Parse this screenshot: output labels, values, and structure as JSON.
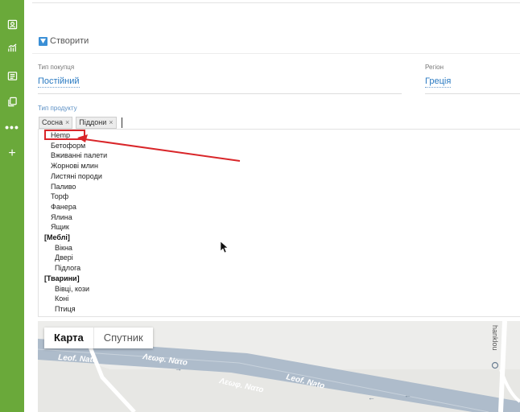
{
  "sidebar": {
    "icons": [
      "contacts-icon",
      "analytics-icon",
      "list-icon",
      "copy-icon",
      "more-icon",
      "add-icon"
    ]
  },
  "form": {
    "create_label": "Створити",
    "buyer_type": {
      "label": "Тип покупця",
      "value": "Постійний"
    },
    "region": {
      "label": "Регіон",
      "value": "Греція"
    },
    "product_type": {
      "label": "Тип продукту",
      "tags": [
        "Сосна",
        "Піддони"
      ]
    }
  },
  "dropdown": {
    "options": [
      {
        "text": "Hemp",
        "group": false
      },
      {
        "text": "Бетоформ",
        "group": false
      },
      {
        "text": "Вживанні палети",
        "group": false
      },
      {
        "text": "Жорнові млин",
        "group": false
      },
      {
        "text": "Листяні породи",
        "group": false
      },
      {
        "text": "Паливо",
        "group": false
      },
      {
        "text": "Торф",
        "group": false
      },
      {
        "text": "Фанера",
        "group": false
      },
      {
        "text": "Ялина",
        "group": false
      },
      {
        "text": "Ящик",
        "group": false
      },
      {
        "text": "[Меблі]",
        "group": true
      },
      {
        "text": "Вікна",
        "group": false
      },
      {
        "text": "Двері",
        "group": false
      },
      {
        "text": "Підлога",
        "group": false
      },
      {
        "text": "[Тварини]",
        "group": true
      },
      {
        "text": "Вівці, кози",
        "group": false
      },
      {
        "text": "Коні",
        "group": false
      },
      {
        "text": "Птиця",
        "group": false
      }
    ]
  },
  "map": {
    "tab_map": "Карта",
    "tab_satellite": "Спутник",
    "road_labels": [
      "Leof. Nato",
      "Λεωφ. Νατο",
      "Λεωφ. Νατο",
      "Leof. Nato"
    ],
    "partial_label": "hanklou"
  },
  "colors": {
    "sidebar": "#6aa93a",
    "link": "#2a7ac2",
    "highlight": "#d9262a"
  }
}
